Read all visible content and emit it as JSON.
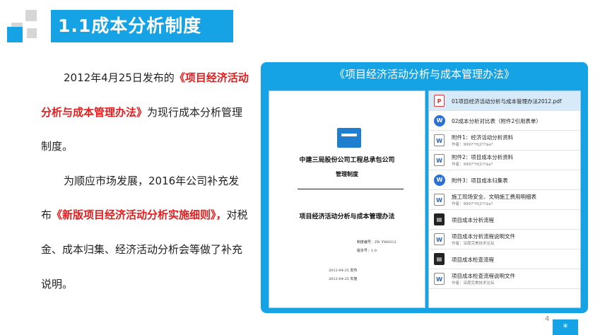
{
  "title": "1.1成本分析制度",
  "body": {
    "p1_a": "2012年4月25日发布的",
    "p1_red": "《项目经济活动分析与成本管理办法》",
    "p1_b": "为现行成本分析管理制度。",
    "p2_a": "为顺应市场发展，2016年公司补充发布",
    "p2_red": "《新版项目经济活动分析实施细则》，",
    "p2_b": "对税金、成本归集、经济活动分析会等做了补充说明。"
  },
  "panel": {
    "title": "《项目经济活动分析与成本管理办法》",
    "doc": {
      "company": "中建三局股份公司工程总承包公司",
      "subtitle": "管理制度",
      "doc_title": "项目经济活动分析与成本管理办法",
      "code": "制度编号：ZB_YW0312",
      "version": "版本号：1.0",
      "date_issue": "2012-04-25  发布",
      "date_impl": "2012-04-25  实施"
    },
    "files": [
      {
        "name": "01项目经济活动分析与成本管理办法2012.pdf",
        "author": "",
        "icon": "pdf-icon",
        "selected": true
      },
      {
        "name": "02成本分析对比表（附件2引用表单）",
        "author": "",
        "icon": "wps-icon"
      },
      {
        "name": "附件1：经济活动分析资料",
        "author": "作者：9997°H|2??$a?",
        "icon": "word-doc-icon"
      },
      {
        "name": "附件2：项目成本分析资料",
        "author": "作者：9997°H|2??$a?",
        "icon": "word-doc-icon"
      },
      {
        "name": "附件3：项目成本归集表",
        "author": "",
        "icon": "wps-icon"
      },
      {
        "name": "施工现场安全、文明施工费用明细表",
        "author": "作者：9997°H|2??$a?",
        "icon": "word-doc-icon"
      },
      {
        "name": "项目成本分析流程",
        "author": "",
        "icon": "flowchart-icon"
      },
      {
        "name": "项目成本分析流程说明文件",
        "author": "作者：深度完美技术论坛",
        "icon": "word-doc-icon"
      },
      {
        "name": "项目成本检查流程",
        "author": "",
        "icon": "flowchart-icon"
      },
      {
        "name": "项目成本检查流程说明文件",
        "author": "作者：深度完美技术论坛",
        "icon": "word-doc-icon"
      }
    ]
  },
  "footer": {
    "page_number": "4",
    "star": "*"
  },
  "colors": {
    "accent": "#16a3e6",
    "red": "#e31d1d"
  }
}
